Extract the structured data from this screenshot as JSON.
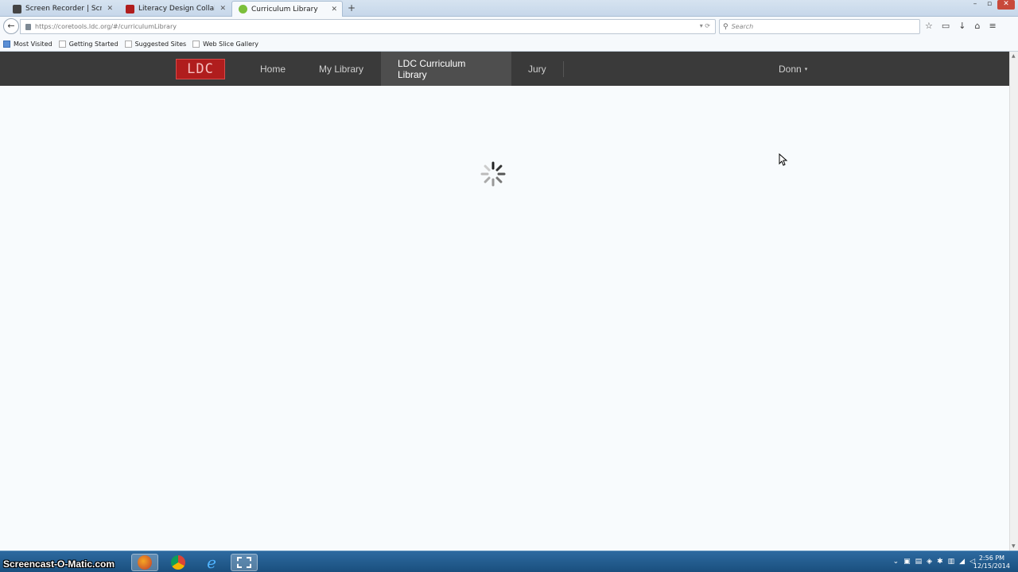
{
  "browser": {
    "tabs": [
      {
        "label": "Screen Recorder | Screenca...",
        "active": false
      },
      {
        "label": "Literacy Design Collaborati...",
        "active": false
      },
      {
        "label": "Curriculum Library",
        "active": true
      }
    ],
    "new_tab": "+",
    "url": "https://coretools.ldc.org/#/curriculumLibrary",
    "search_placeholder": "Search",
    "bookmarks": [
      "Most Visited",
      "Getting Started",
      "Suggested Sites",
      "Web Slice Gallery"
    ]
  },
  "app": {
    "logo": "LDC",
    "menu": [
      "Home",
      "My Library",
      "LDC Curriculum Library",
      "Jury"
    ],
    "active_menu": "LDC Curriculum Library",
    "user": "Donn",
    "caret": "▾"
  },
  "taskbar": {
    "watermark": "Screencast-O-Matic.com",
    "time": "2:56 PM",
    "date": "12/15/2014"
  },
  "colors": {
    "appbar": "#3a3a3a",
    "logo": "#b01d1d",
    "taskbar": "#1a4f7e"
  }
}
